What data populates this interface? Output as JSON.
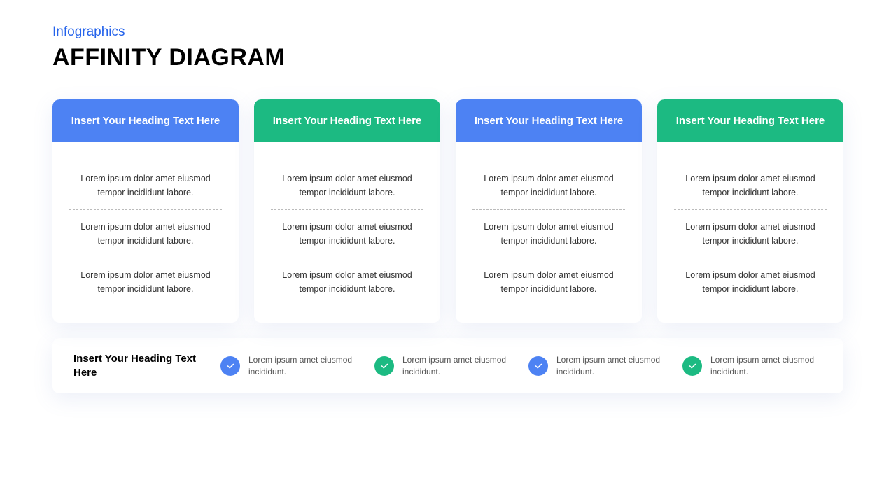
{
  "subtitle": "Infographics",
  "title": "AFFINITY DIAGRAM",
  "colors": {
    "blue": "#4d82f3",
    "green": "#1cba82"
  },
  "cards": [
    {
      "heading": "Insert Your Heading Text Here",
      "color": "blue",
      "items": [
        "Lorem ipsum dolor amet eiusmod tempor incididunt  labore.",
        "Lorem ipsum dolor amet eiusmod tempor incididunt  labore.",
        "Lorem ipsum dolor amet eiusmod tempor incididunt  labore."
      ]
    },
    {
      "heading": "Insert Your Heading Text Here",
      "color": "green",
      "items": [
        "Lorem ipsum dolor amet eiusmod tempor incididunt  labore.",
        "Lorem ipsum dolor amet eiusmod tempor incididunt  labore.",
        "Lorem ipsum dolor amet eiusmod tempor incididunt  labore."
      ]
    },
    {
      "heading": "Insert Your Heading Text Here",
      "color": "blue",
      "items": [
        "Lorem ipsum dolor amet eiusmod tempor incididunt  labore.",
        "Lorem ipsum dolor amet eiusmod tempor incididunt  labore.",
        "Lorem ipsum dolor amet eiusmod tempor incididunt  labore."
      ]
    },
    {
      "heading": "Insert Your Heading Text Here",
      "color": "green",
      "items": [
        "Lorem ipsum dolor amet eiusmod tempor incididunt  labore.",
        "Lorem ipsum dolor amet eiusmod tempor incididunt  labore.",
        "Lorem ipsum dolor amet eiusmod tempor incididunt  labore."
      ]
    }
  ],
  "footer": {
    "heading": "Insert Your Heading Text Here",
    "items": [
      {
        "color": "blue",
        "text": "Lorem ipsum amet eiusmod incididunt."
      },
      {
        "color": "green",
        "text": "Lorem ipsum amet eiusmod incididunt."
      },
      {
        "color": "blue",
        "text": "Lorem ipsum amet eiusmod incididunt."
      },
      {
        "color": "green",
        "text": "Lorem ipsum amet eiusmod incididunt."
      }
    ]
  }
}
